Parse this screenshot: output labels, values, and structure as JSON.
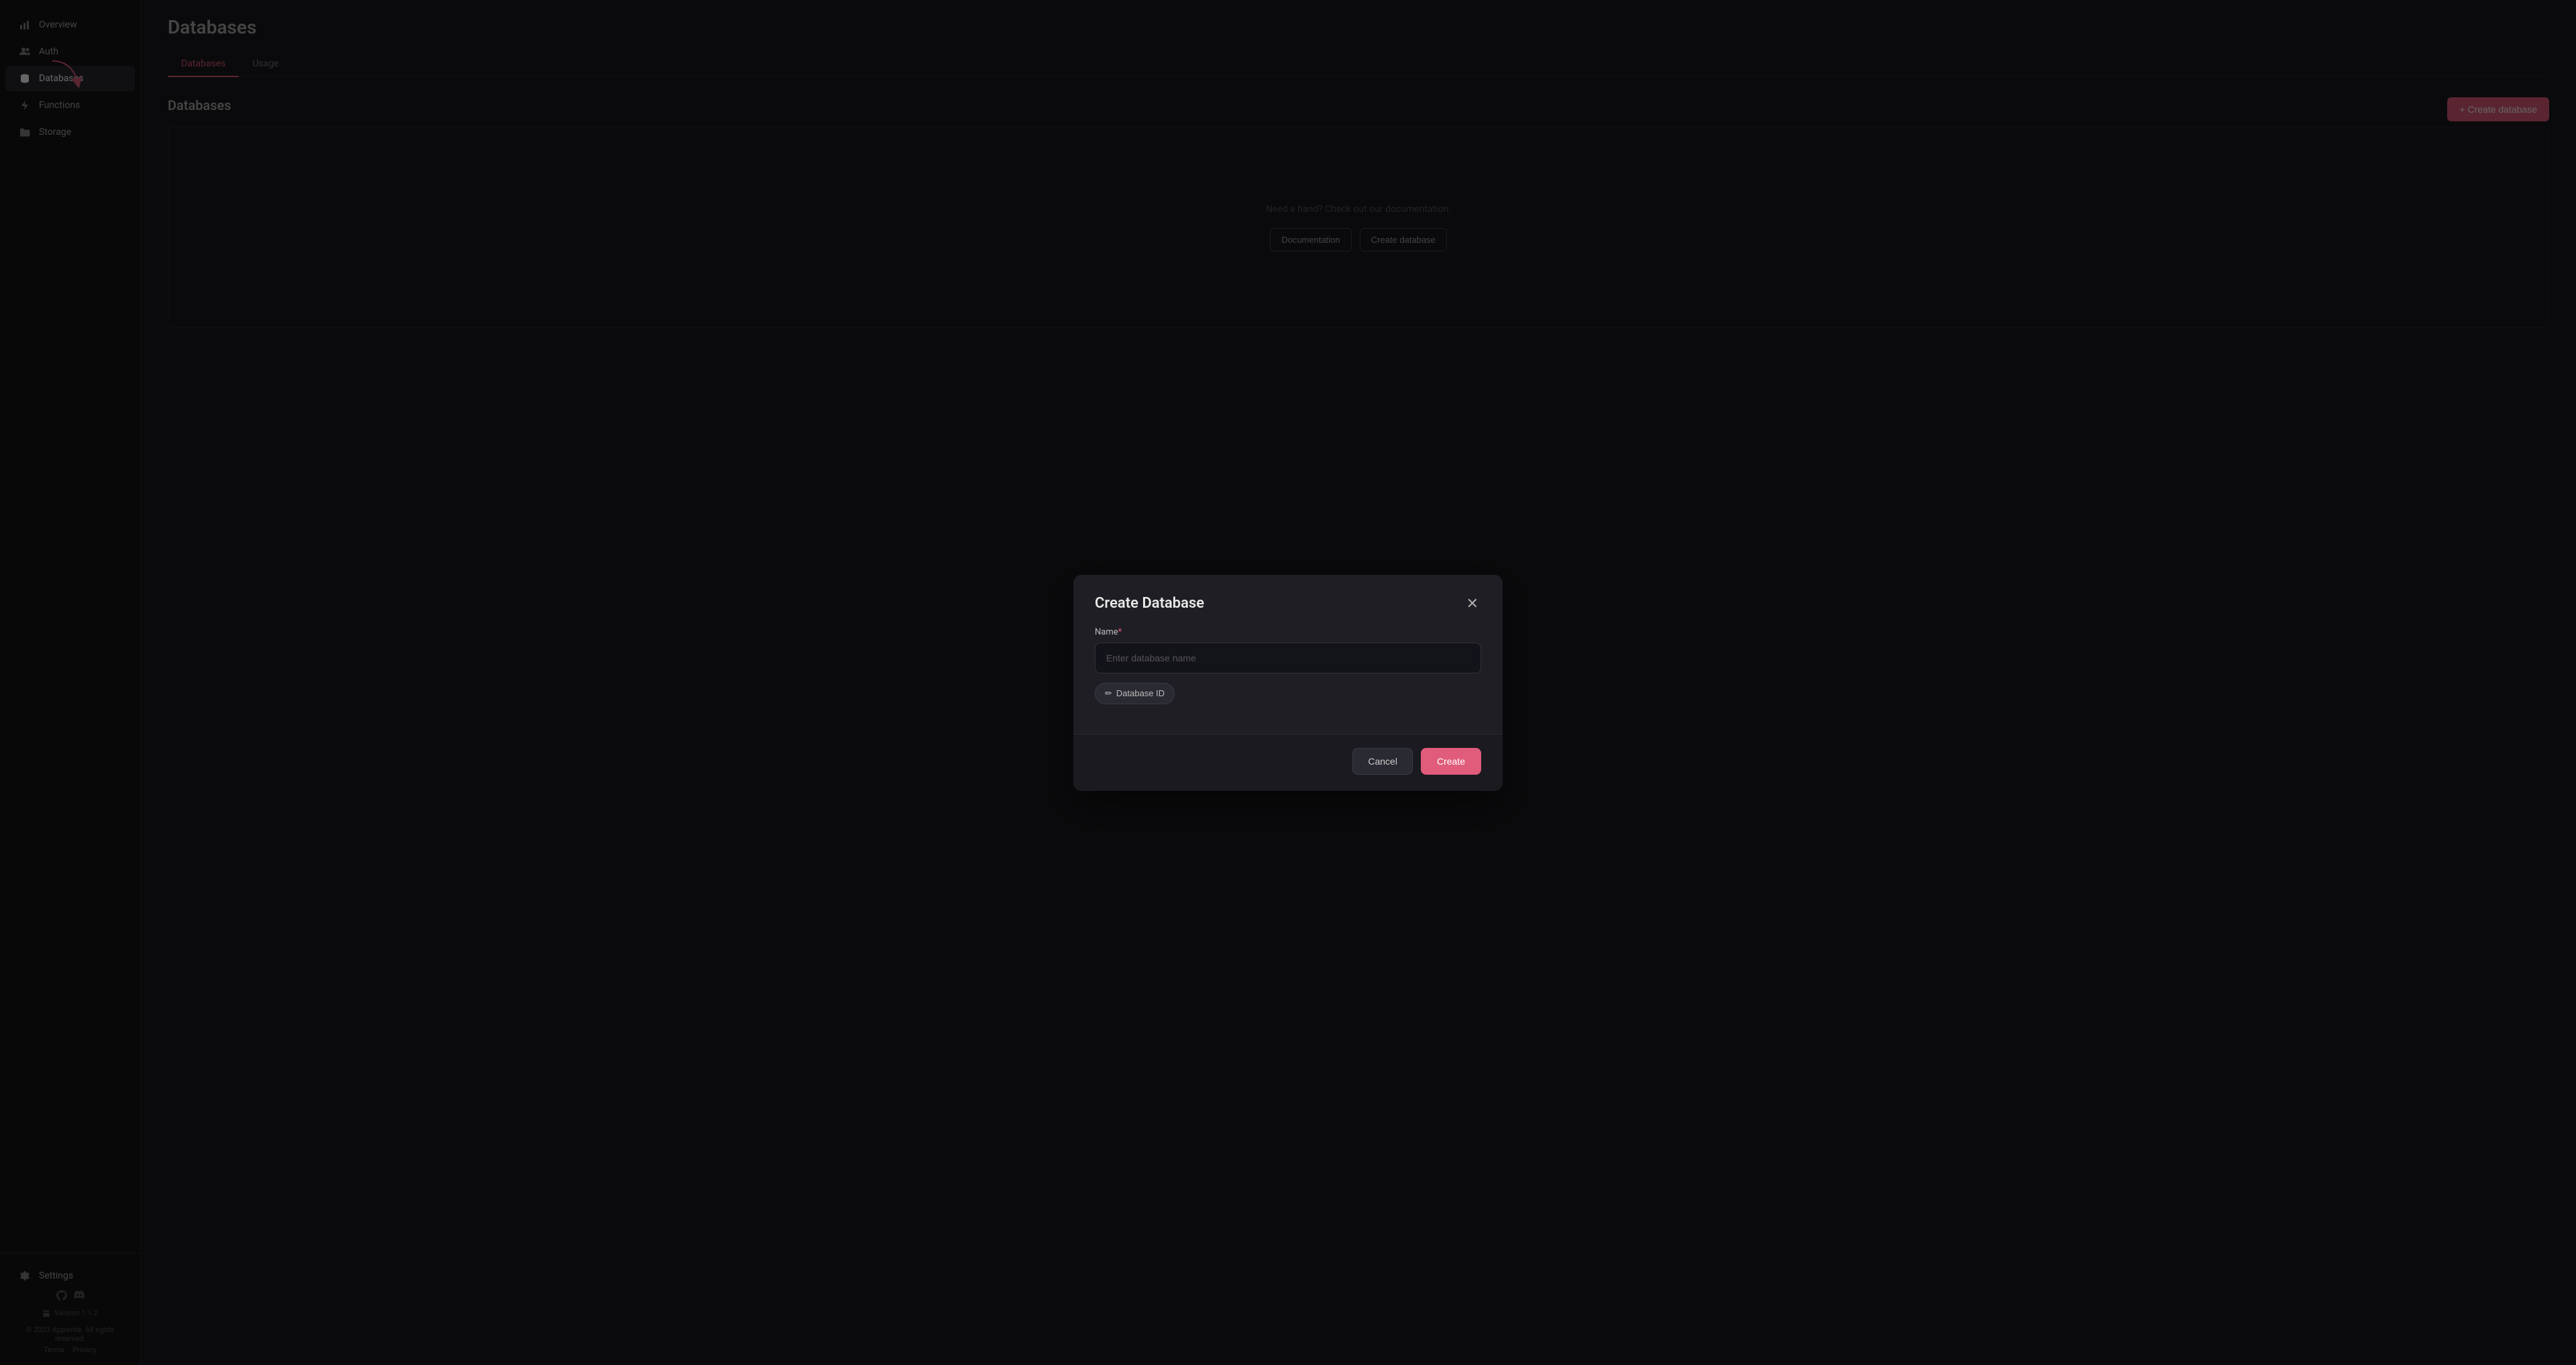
{
  "sidebar": {
    "items": [
      {
        "id": "overview",
        "label": "Overview",
        "icon": "chart-bar"
      },
      {
        "id": "auth",
        "label": "Auth",
        "icon": "users"
      },
      {
        "id": "databases",
        "label": "Databases",
        "icon": "database",
        "active": true
      },
      {
        "id": "functions",
        "label": "Functions",
        "icon": "lightning"
      },
      {
        "id": "storage",
        "label": "Storage",
        "icon": "folder"
      }
    ],
    "bottom": [
      {
        "id": "settings",
        "label": "Settings",
        "icon": "gear"
      }
    ]
  },
  "footer": {
    "copyright": "© 2023 Appwrite. All rights reserved.",
    "links": [
      "Terms",
      "Privacy"
    ],
    "version": "Version 1.1.2"
  },
  "page": {
    "title": "Databases",
    "tabs": [
      {
        "id": "databases",
        "label": "Databases",
        "active": true
      },
      {
        "id": "usage",
        "label": "Usage",
        "active": false
      }
    ]
  },
  "content": {
    "section_title": "Databases",
    "create_button": "+ Create database",
    "empty_text": "Need a hand? Check out our documentation.",
    "doc_button": "Documentation",
    "create_db_button": "Create database"
  },
  "modal": {
    "title": "Create Database",
    "name_label": "Name",
    "name_placeholder": "Enter database name",
    "db_id_label": "Database ID",
    "cancel_label": "Cancel",
    "create_label": "Create"
  }
}
